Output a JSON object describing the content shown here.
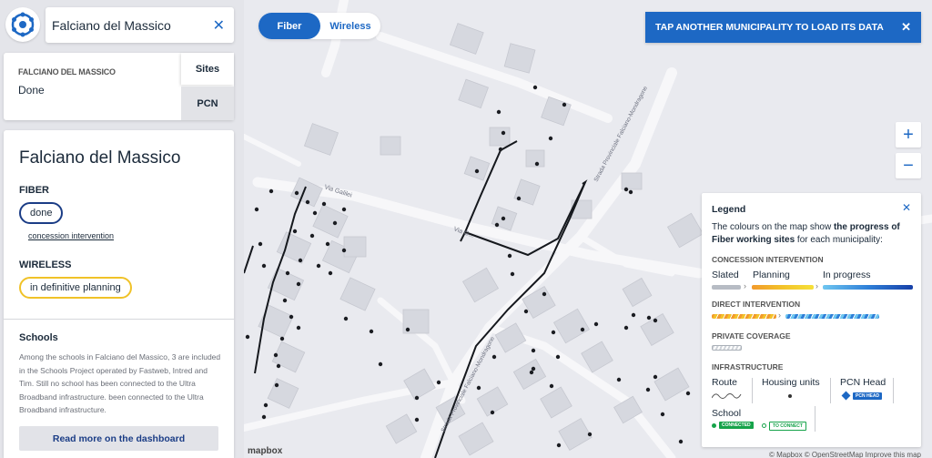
{
  "search": {
    "value": "Falciano del Massico",
    "clear_icon": "close-icon"
  },
  "status_card": {
    "municipality": "FALCIANO DEL MASSICO",
    "state": "Done",
    "tab_sites": "Sites",
    "tab_pcn": "PCN"
  },
  "details": {
    "title": "Falciano del Massico",
    "fiber_heading": "FIBER",
    "fiber_status": "done",
    "fiber_link": "concession intervention",
    "wireless_heading": "WIRELESS",
    "wireless_status": "in definitive planning",
    "schools_heading": "Schools",
    "schools_text": "Among the schools in Falciano del Massico, 3 are included in the Schools Project operated by Fastweb, Intred and Tim. Still no school has been connected to the Ultra Broadband infrastructure. been connected to the Ultra Broadband infrastructure.",
    "read_more": "Read more on the dashboard"
  },
  "toggle": {
    "fiber": "Fiber",
    "wireless": "Wireless",
    "selected": "Fiber"
  },
  "banner": {
    "text": "TAP ANOTHER MUNICIPALITY TO LOAD ITS DATA"
  },
  "zoom": {
    "in": "+",
    "out": "−"
  },
  "map_labels": {
    "via_galilei": "Via Galilei",
    "via_short": "Via G...",
    "road_1": "Strada Provinciale Falciano-Mondragone",
    "road_2": "Strada Provinciale Falciano-Mondragone"
  },
  "legend": {
    "title": "Legend",
    "description_plain": "The colours on the map show ",
    "description_bold": "the progress of Fiber working sites",
    "description_tail": " for each municipality:",
    "concession_heading": "CONCESSION INTERVENTION",
    "slated": "Slated",
    "planning": "Planning",
    "in_progress": "In progress",
    "direct_heading": "DIRECT INTERVENTION",
    "private_heading": "PRIVATE COVERAGE",
    "infrastructure_heading": "INFRASTRUCTURE",
    "route": "Route",
    "housing_units": "Housing units",
    "pcn_head": "PCN Head",
    "pcn_head_tag": "PCN HEAD",
    "school": "School",
    "connected_tag": "CONNECTED",
    "to_connect_tag": "TO CONNECT"
  },
  "attribution": {
    "mapbox": "mapbox",
    "text": "© Mapbox © OpenStreetMap Improve this map"
  },
  "colors": {
    "accent": "#1d68c4",
    "fiber_done_border": "#1b3d86",
    "wireless_border": "#f0c228",
    "slated": "#b7bcc4",
    "planning": "#f3c32a",
    "in_progress": "#1740a8",
    "connected": "#16a34a"
  }
}
